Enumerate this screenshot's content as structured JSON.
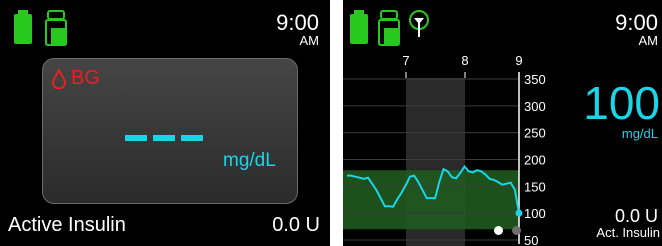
{
  "left_screen": {
    "time": "9:00",
    "ampm": "AM",
    "bg_card": {
      "label": "BG",
      "value": "---",
      "unit": "mg/dL"
    },
    "footer": {
      "label": "Active Insulin",
      "value": "0.0 U"
    }
  },
  "right_screen": {
    "time": "9:00",
    "ampm": "AM",
    "bg_value": "100",
    "bg_unit": "mg/dL",
    "insulin_value": "0.0 U",
    "insulin_label": "Act. Insulin",
    "page_indicator": {
      "pages": 2,
      "active": 1
    }
  },
  "chart_data": {
    "type": "line",
    "x_tick_labels": [
      "7",
      "8",
      "9"
    ],
    "y_tick_labels": [
      "350",
      "300",
      "250",
      "200",
      "150",
      "100",
      "50"
    ],
    "ylim": [
      50,
      350
    ],
    "target_range": [
      70,
      180
    ],
    "series": [
      {
        "values": [
          [
            0,
            170
          ],
          [
            1,
            170
          ],
          [
            2,
            168
          ],
          [
            3,
            166
          ],
          [
            4,
            164
          ],
          [
            5,
            166
          ],
          [
            6,
            155
          ],
          [
            7,
            143
          ],
          [
            8,
            128
          ],
          [
            9,
            113
          ],
          [
            10,
            113
          ],
          [
            11,
            112
          ],
          [
            12,
            126
          ],
          [
            13,
            138
          ],
          [
            14,
            152
          ],
          [
            15,
            168
          ],
          [
            16,
            170
          ],
          [
            17,
            158
          ],
          [
            18,
            143
          ],
          [
            19,
            128
          ],
          [
            20,
            128
          ],
          [
            21,
            128
          ],
          [
            22,
            158
          ],
          [
            23,
            182
          ],
          [
            24,
            178
          ],
          [
            25,
            167
          ],
          [
            26,
            165
          ],
          [
            27,
            175
          ],
          [
            28,
            187
          ],
          [
            29,
            178
          ],
          [
            30,
            176
          ],
          [
            31,
            180
          ],
          [
            32,
            178
          ],
          [
            33,
            172
          ],
          [
            34,
            164
          ],
          [
            35,
            162
          ],
          [
            36,
            158
          ],
          [
            37,
            153
          ],
          [
            38,
            155
          ],
          [
            39,
            157
          ],
          [
            40,
            144
          ],
          [
            41,
            100
          ]
        ]
      }
    ]
  },
  "colors": {
    "accent_cyan": "#1ad5e8",
    "battery_green": "#28c81e",
    "target_band": "#1f5a1f",
    "drop_red": "#e52222"
  },
  "icons": [
    "battery-icon",
    "insulin-vial-icon",
    "signal-antenna-icon",
    "blood-drop-icon"
  ]
}
